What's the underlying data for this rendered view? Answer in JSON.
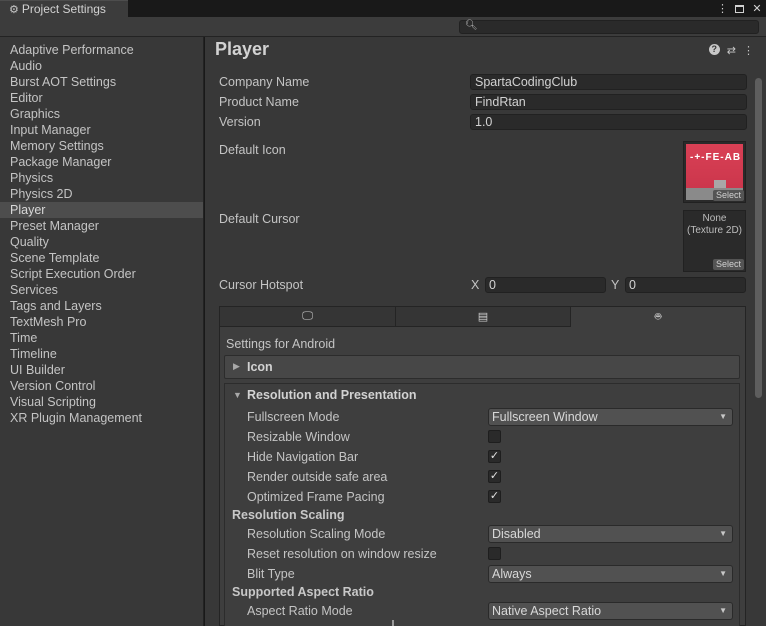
{
  "window": {
    "title": "Project Settings"
  },
  "sidebar": {
    "items": [
      "Adaptive Performance",
      "Audio",
      "Burst AOT Settings",
      "Editor",
      "Graphics",
      "Input Manager",
      "Memory Settings",
      "Package Manager",
      "Physics",
      "Physics 2D",
      "Player",
      "Preset Manager",
      "Quality",
      "Scene Template",
      "Script Execution Order",
      "Services",
      "Tags and Layers",
      "TextMesh Pro",
      "Time",
      "Timeline",
      "UI Builder",
      "Version Control",
      "Visual Scripting",
      "XR Plugin Management"
    ],
    "selected": "Player"
  },
  "player": {
    "title": "Player",
    "company_label": "Company Name",
    "company_value": "SpartaCodingClub",
    "product_label": "Product Name",
    "product_value": "FindRtan",
    "version_label": "Version",
    "version_value": "1.0",
    "default_icon_label": "Default Icon",
    "default_cursor_label": "Default Cursor",
    "cursor_none_line1": "None",
    "cursor_none_line2": "(Texture 2D)",
    "select_label": "Select",
    "hotspot_label": "Cursor Hotspot",
    "x_label": "X",
    "x_value": "0",
    "y_label": "Y",
    "y_value": "0"
  },
  "platform": {
    "settings_for": "Settings for Android",
    "icon_section": "Icon",
    "resolution_section": "Resolution and Presentation",
    "fullscreen_label": "Fullscreen Mode",
    "fullscreen_value": "Fullscreen Window",
    "resizable_label": "Resizable Window",
    "resizable_checked": false,
    "hide_nav_label": "Hide Navigation Bar",
    "hide_nav_checked": true,
    "render_safe_label": "Render outside safe area",
    "render_safe_checked": true,
    "frame_pacing_label": "Optimized Frame Pacing",
    "frame_pacing_checked": true,
    "resolution_scaling_header": "Resolution Scaling",
    "scaling_mode_label": "Resolution Scaling Mode",
    "scaling_mode_value": "Disabled",
    "reset_res_label": "Reset resolution on window resize",
    "reset_res_checked": false,
    "blit_label": "Blit Type",
    "blit_value": "Always",
    "aspect_header": "Supported Aspect Ratio",
    "aspect_mode_label": "Aspect Ratio Mode",
    "aspect_mode_value": "Native Aspect Ratio"
  }
}
